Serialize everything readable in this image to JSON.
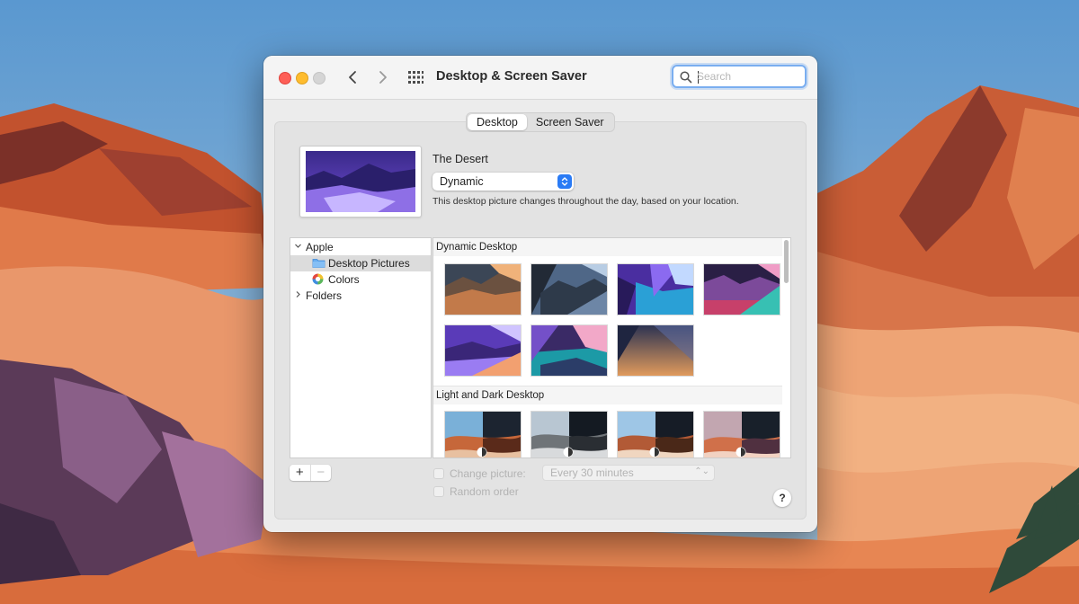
{
  "window": {
    "title": "Desktop & Screen Saver"
  },
  "search": {
    "placeholder": "Search"
  },
  "tabs": [
    {
      "label": "Desktop",
      "active": true
    },
    {
      "label": "Screen Saver",
      "active": false
    }
  ],
  "current_picture": {
    "name": "The Desert",
    "mode": "Dynamic",
    "description": "This desktop picture changes throughout the day, based on your location."
  },
  "sidebar": {
    "items": [
      {
        "label": "Apple",
        "expanded": true,
        "icon": "chevron-down-icon"
      },
      {
        "label": "Desktop Pictures",
        "selected": true,
        "icon": "folder-icon"
      },
      {
        "label": "Colors",
        "icon": "color-wheel-icon"
      },
      {
        "label": "Folders",
        "expanded": false,
        "icon": "chevron-right-icon"
      }
    ]
  },
  "buttons": {
    "add": "+",
    "remove": "−",
    "help": "?"
  },
  "gallery": {
    "sections": [
      {
        "title": "Dynamic Desktop",
        "count": 7
      },
      {
        "title": "Light and Dark Desktop",
        "count": 4
      }
    ]
  },
  "options": {
    "change_picture_label": "Change picture:",
    "change_picture_checked": false,
    "interval": "Every 30 minutes",
    "random_order_label": "Random order",
    "random_order_checked": false
  },
  "colors": {
    "accent": "#2a7bf5",
    "close": "#fe5f57",
    "minimize": "#febc2e",
    "zoom_inactive": "#d5d5d5"
  }
}
